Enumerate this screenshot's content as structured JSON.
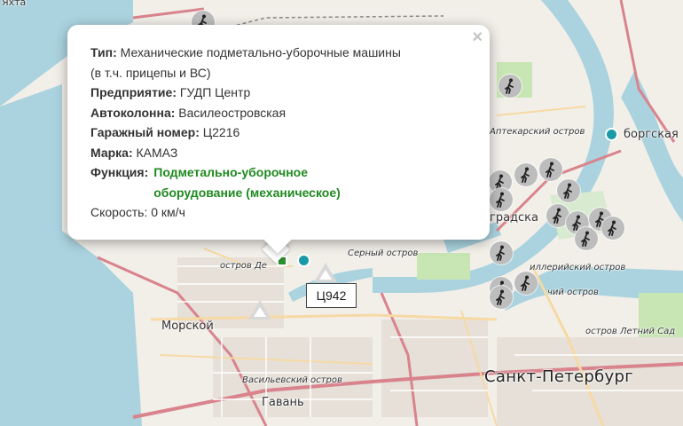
{
  "map": {
    "labels": {
      "yakhta": "Яхта",
      "aptekarsky": "Аптекарский остров",
      "vyborgskaya": "боргская",
      "gradskaya": "градска",
      "serny": "Серный остров",
      "ostrov_d": "остров Де",
      "zayachy": "иллерийский остров",
      "chiy": "чий остров",
      "morskoy": "Морской",
      "vasilievsky": "Васильевский остров",
      "letny": "остров Летний Сад",
      "gavan": "Гавань",
      "spb": "Санкт-Петербург"
    },
    "colors": {
      "water": "#aad3df",
      "land": "#f2efe9",
      "park": "#c8e6b4",
      "road_main": "#d9838d",
      "road_secondary": "#f7d9a4",
      "marker_gray": "#bdbdbd",
      "marker_teal": "#1a99a6",
      "function_green": "#1f8a1f"
    },
    "markers": {
      "person_icon": "walking-person-icon",
      "dot_icon": "teal-dot",
      "triangle_icon": "triangle-marker"
    }
  },
  "popup": {
    "close_label": "×",
    "type_label": "Тип:",
    "type_value": "Механические подметально-уборочные машины",
    "type_value_cont": "(в т.ч. прицепы и ВС)",
    "enterprise_label": "Предприятие:",
    "enterprise_value": "ГУДП Центр",
    "column_label": "Автоколонна:",
    "column_value": "Василеостровская",
    "garage_label": "Гаражный номер:",
    "garage_value": "Ц2216",
    "brand_label": "Марка:",
    "brand_value": "КАМАЗ",
    "function_label": "Функция:",
    "function_value": "Подметально-уборочное оборудование (механическое)",
    "speed_label": "Скорость:",
    "speed_value": "0 км/ч"
  },
  "tooltip": {
    "label": "Ц942"
  }
}
